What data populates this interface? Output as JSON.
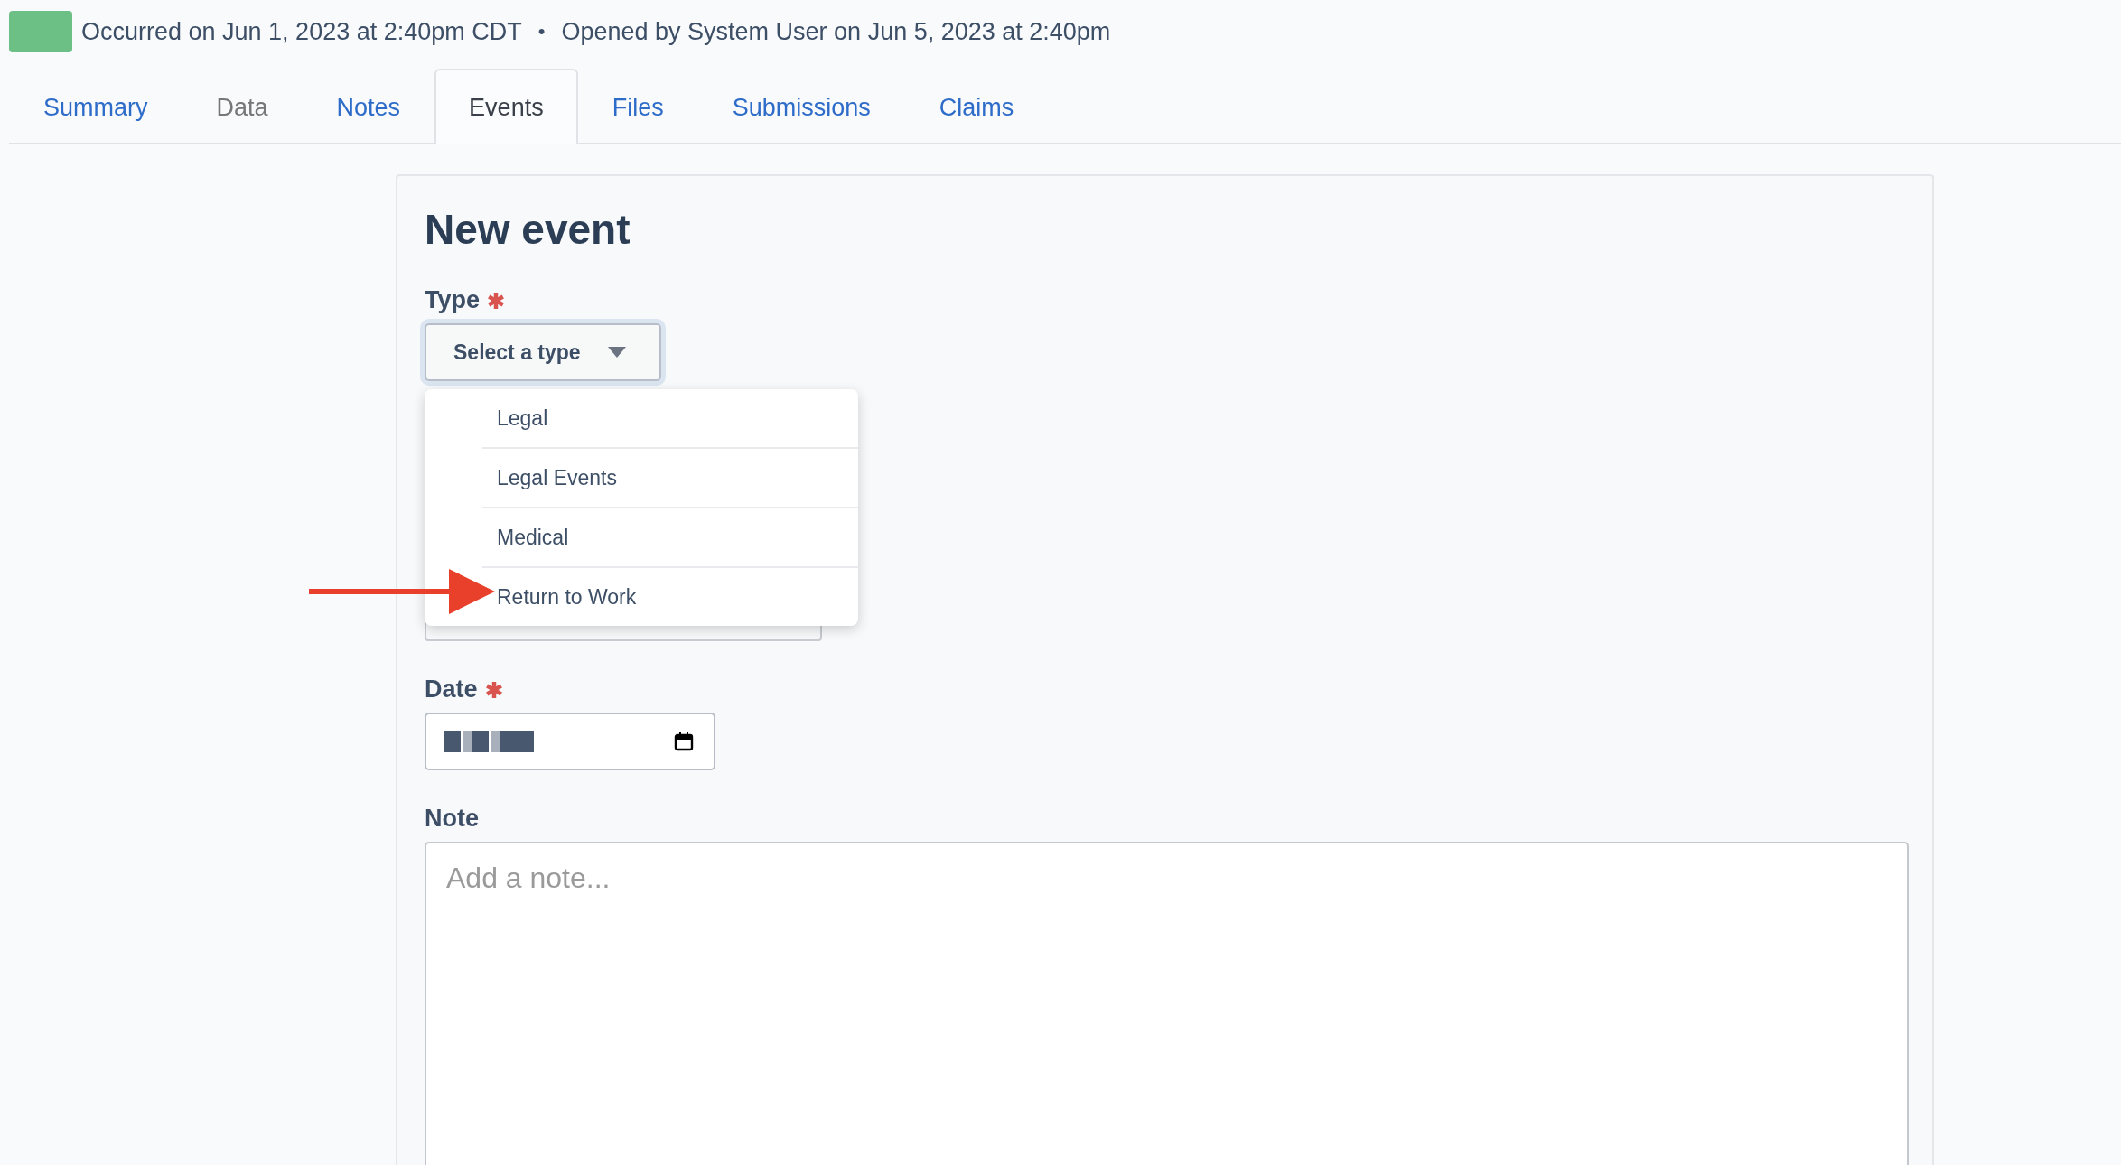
{
  "header": {
    "occurred": "Occurred on Jun 1, 2023 at 2:40pm CDT",
    "separator": "•",
    "opened": "Opened by System User on Jun 5, 2023 at 2:40pm"
  },
  "tabs": [
    {
      "label": "Summary",
      "selected": false,
      "disabled": false
    },
    {
      "label": "Data",
      "selected": false,
      "disabled": true
    },
    {
      "label": "Notes",
      "selected": false,
      "disabled": false
    },
    {
      "label": "Events",
      "selected": true,
      "disabled": false
    },
    {
      "label": "Files",
      "selected": false,
      "disabled": false
    },
    {
      "label": "Submissions",
      "selected": false,
      "disabled": false
    },
    {
      "label": "Claims",
      "selected": false,
      "disabled": false
    }
  ],
  "form": {
    "title": "New event",
    "fields": [
      {
        "kind": "select",
        "label": "Type",
        "required": true,
        "value": "Select a type",
        "expanded": true,
        "options": [
          "Legal",
          "Legal Events",
          "Medical",
          "Return to Work"
        ]
      },
      {
        "kind": "covered"
      },
      {
        "kind": "date",
        "label": "Date",
        "required": true
      },
      {
        "kind": "textarea",
        "label": "Note",
        "required": false,
        "placeholder": "Add a note..."
      }
    ]
  }
}
